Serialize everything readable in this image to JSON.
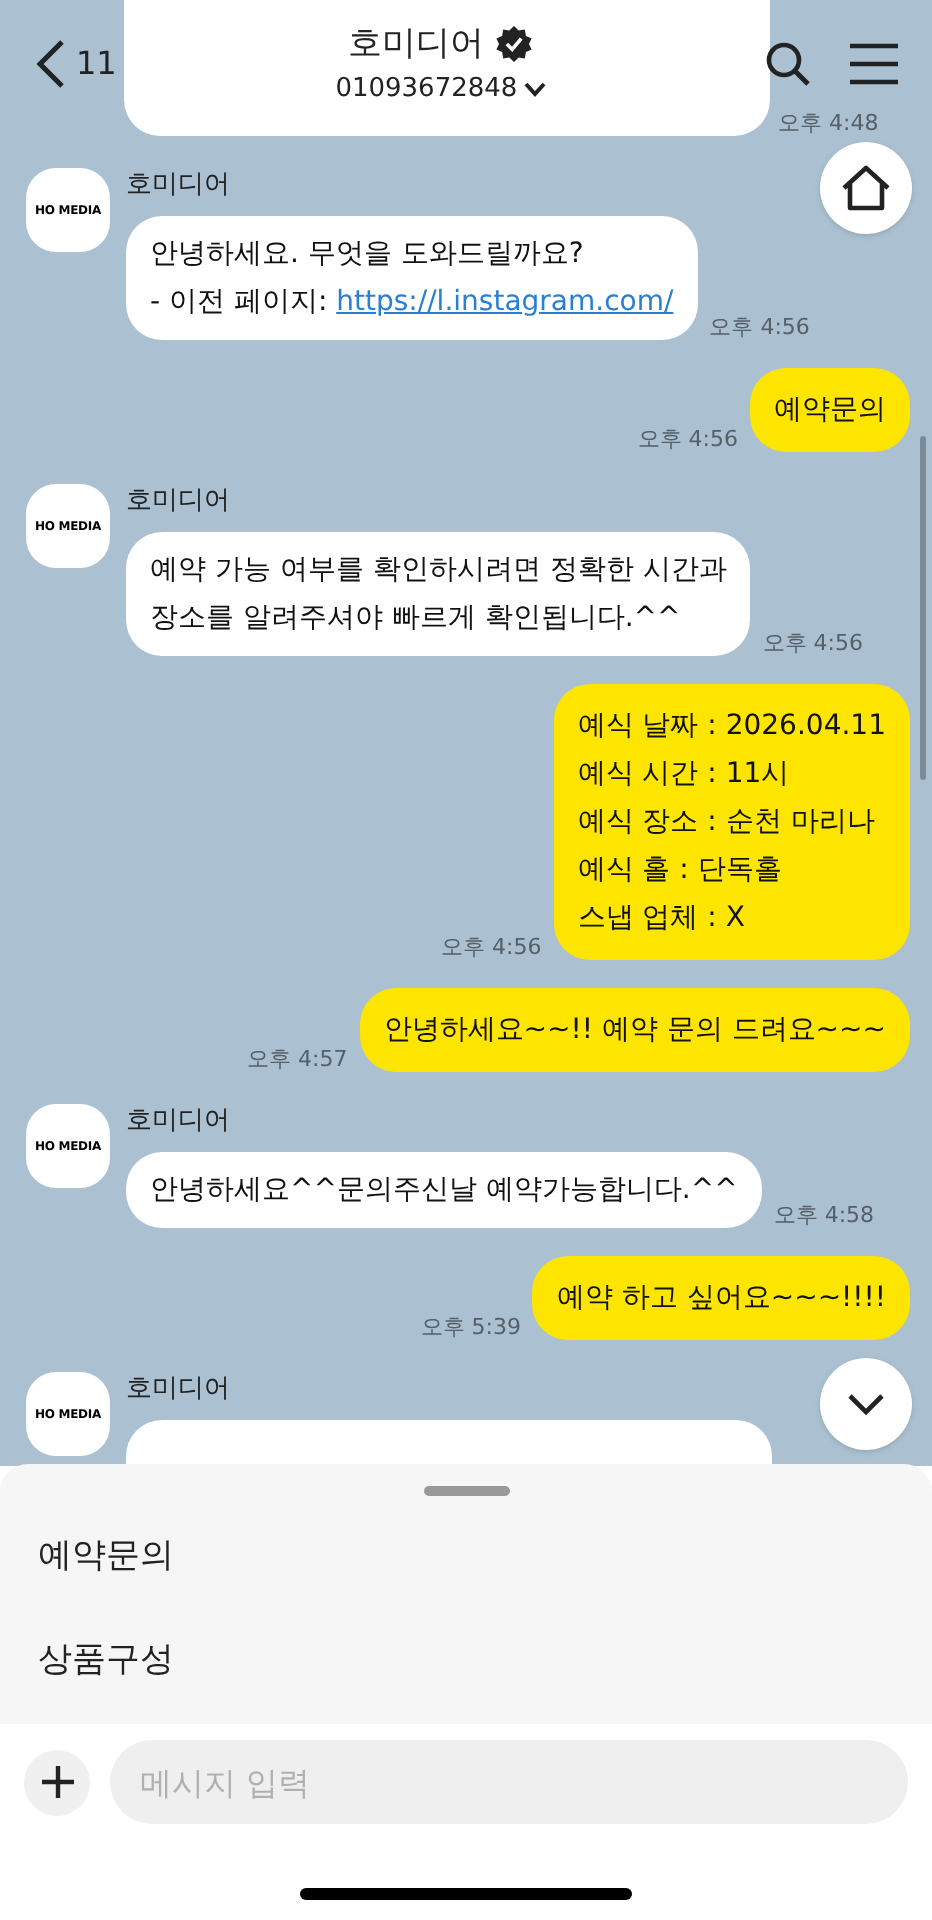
{
  "header": {
    "back_count": "11",
    "title": "호미디어",
    "verified": true,
    "subtitle": "01093672848"
  },
  "messages": [
    {
      "kind": "cut",
      "time": "오후 4:48"
    },
    {
      "kind": "received",
      "sender": "호미디어",
      "avatar_text": "HO MEDIA",
      "lines": [
        "안녕하세요. 무엇을 도와드릴까요?"
      ],
      "prefix": "- 이전 페이지: ",
      "link": "https://l.instagram.com/",
      "time": "오후 4:56"
    },
    {
      "kind": "sent",
      "lines": [
        "예약문의"
      ],
      "time": "오후 4:56"
    },
    {
      "kind": "received",
      "sender": "호미디어",
      "avatar_text": "HO MEDIA",
      "lines": [
        "예약 가능 여부를 확인하시려면 정확한 시간과",
        "장소를 알려주셔야 빠르게 확인됩니다.^^"
      ],
      "time": "오후 4:56"
    },
    {
      "kind": "sent",
      "lines": [
        "예식 날짜 : 2026.04.11",
        "예식 시간 : 11시",
        "예식 장소 : 순천 마리나",
        "예식 홀 : 단독홀",
        "스냅 업체 : X"
      ],
      "time": "오후 4:56"
    },
    {
      "kind": "sent",
      "lines": [
        "안녕하세요~~!! 예약 문의 드려요~~~"
      ],
      "time": "오후 4:57"
    },
    {
      "kind": "received",
      "sender": "호미디어",
      "avatar_text": "HO MEDIA",
      "lines": [
        "안녕하세요^^문의주신날 예약가능합니다.^^"
      ],
      "time": "오후 4:58"
    },
    {
      "kind": "sent",
      "lines": [
        "예약 하고 싶어요~~~!!!!"
      ],
      "time": "오후 5:39"
    },
    {
      "kind": "received",
      "sender": "호미디어",
      "avatar_text": "HO MEDIA"
    }
  ],
  "quick_replies": [
    "예약문의",
    "상품구성"
  ],
  "composer": {
    "placeholder": "메시지 입력"
  }
}
